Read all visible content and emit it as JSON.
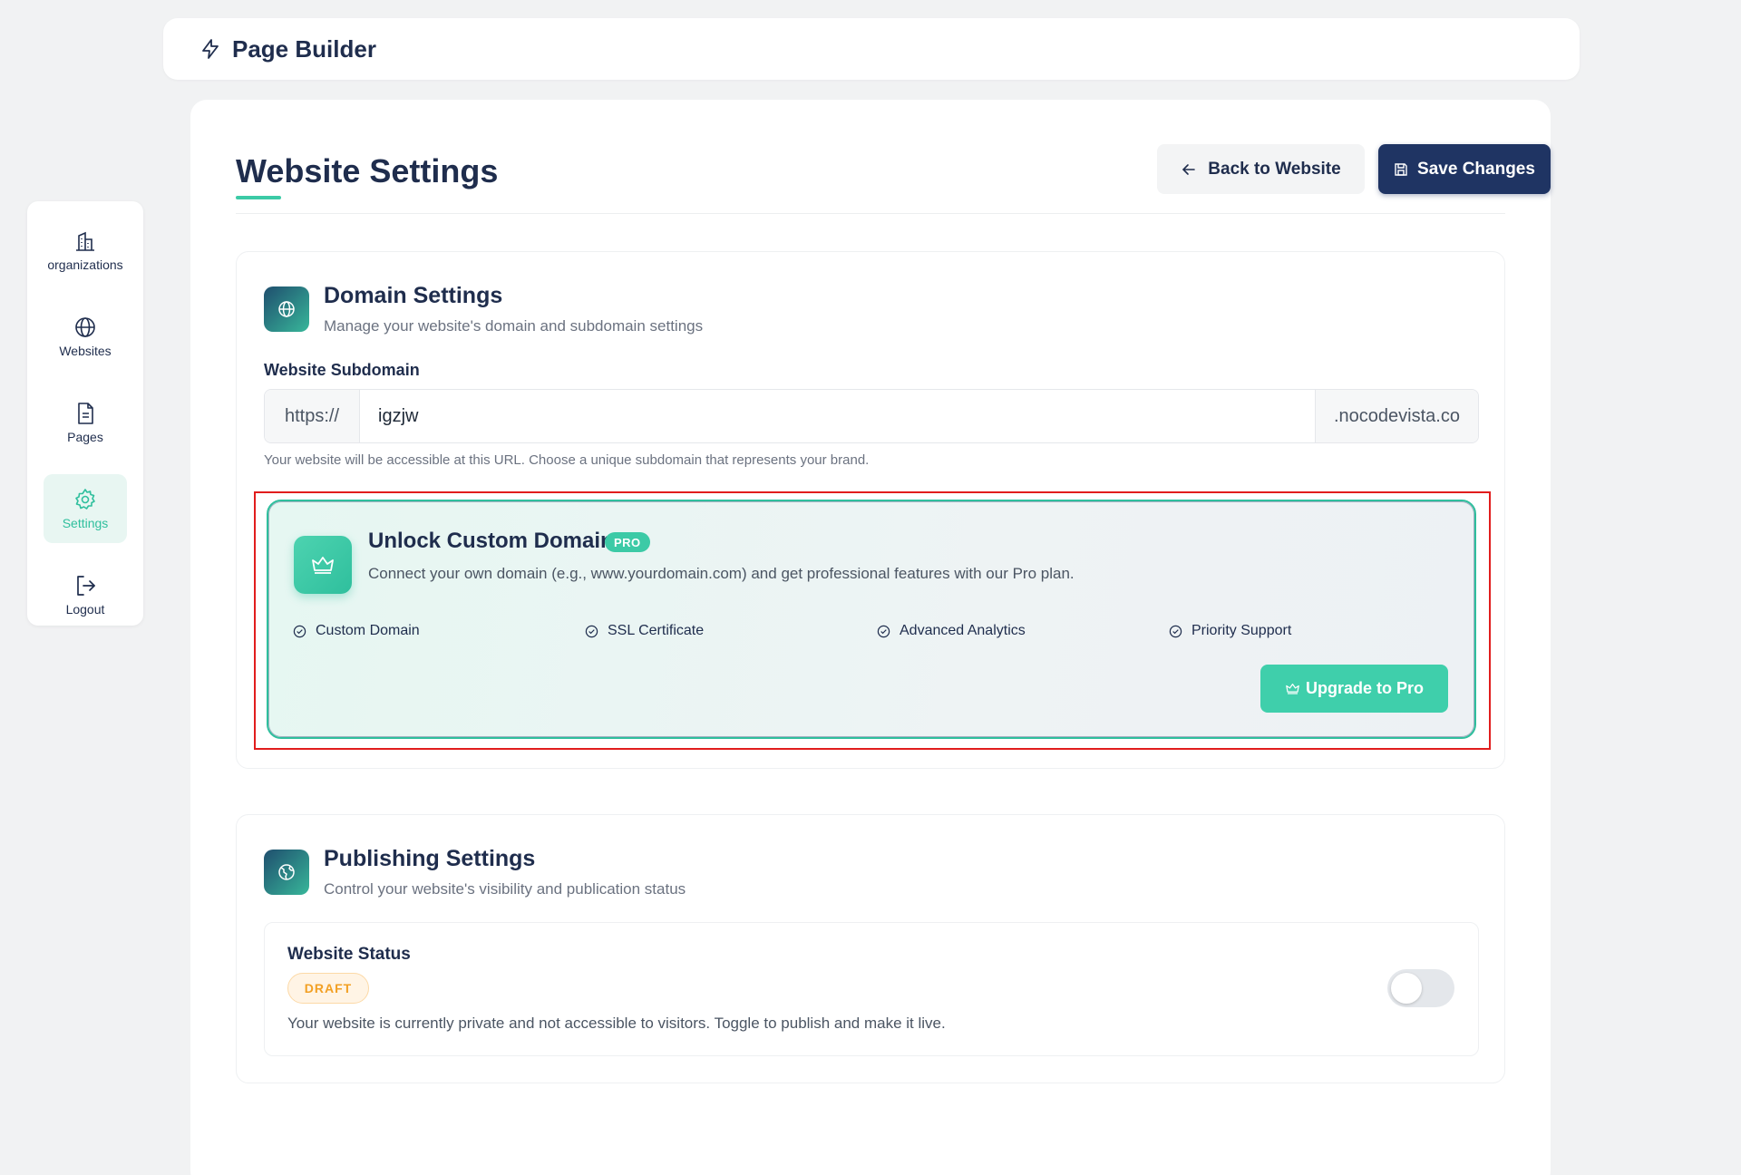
{
  "topbar": {
    "title": "Page Builder",
    "icon": "lightning-icon"
  },
  "sidebar": {
    "items": [
      {
        "label": "organizations",
        "icon": "building-icon",
        "active": false
      },
      {
        "label": "Websites",
        "icon": "globe-icon",
        "active": false
      },
      {
        "label": "Pages",
        "icon": "document-icon",
        "active": false
      },
      {
        "label": "Settings",
        "icon": "gear-icon",
        "active": true
      },
      {
        "label": "Logout",
        "icon": "logout-icon",
        "active": false
      }
    ]
  },
  "header": {
    "title": "Website Settings",
    "back_label": "Back to Website",
    "save_label": "Save Changes"
  },
  "domain": {
    "title": "Domain Settings",
    "subtitle": "Manage your website's domain and subdomain settings",
    "field_label": "Website Subdomain",
    "prefix": "https://",
    "value": "igzjw",
    "suffix": ".nocodevista.co",
    "help": "Your website will be accessible at this URL. Choose a unique subdomain that represents your brand."
  },
  "promo": {
    "title": "Unlock Custom Domain",
    "badge": "PRO",
    "description": "Connect your own domain (e.g., www.yourdomain.com) and get professional features with our Pro plan.",
    "features": [
      "Custom Domain",
      "SSL Certificate",
      "Advanced Analytics",
      "Priority Support"
    ],
    "button": "Upgrade to Pro"
  },
  "publishing": {
    "title": "Publishing Settings",
    "subtitle": "Control your website's visibility and publication status",
    "status_label": "Website Status",
    "status_badge": "DRAFT",
    "status_description": "Your website is currently private and not accessible to visitors. Toggle to publish and make it live.",
    "published": false
  },
  "colors": {
    "accent": "#3ccaa6",
    "navy": "#1f3463",
    "draft": "#f2a024",
    "highlight": "#e11d1d"
  }
}
